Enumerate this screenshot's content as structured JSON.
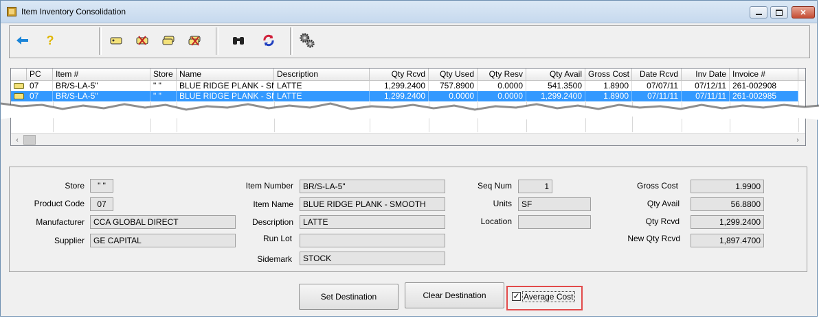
{
  "window": {
    "title": "Item Inventory Consolidation"
  },
  "toolbar": {
    "buttons": [
      {
        "name": "back-arrow-icon",
        "glyph": "🡄"
      },
      {
        "name": "help-icon",
        "glyph": "?"
      },
      {
        "name": "tag-icon",
        "glyph": "🏷"
      },
      {
        "name": "tag-delete-icon",
        "glyph": "🏷"
      },
      {
        "name": "tag-stack-icon",
        "glyph": "🏷"
      },
      {
        "name": "tag-remove-icon",
        "glyph": "🏷"
      },
      {
        "name": "binoculars-icon",
        "glyph": "👓"
      },
      {
        "name": "refresh-icon",
        "glyph": "⟳"
      },
      {
        "name": "settings-gears-icon",
        "glyph": "⚙"
      }
    ]
  },
  "grid": {
    "columns": [
      "PC",
      "Item #",
      "Store",
      "Name",
      "Description",
      "Qty Rcvd",
      "Qty Used",
      "Qty Resv",
      "Qty Avail",
      "Gross Cost",
      "Date Rcvd",
      "Inv Date",
      "Invoice #"
    ],
    "rows": [
      [
        "07",
        "BR/S-LA-5\"",
        "\" \"",
        "BLUE RIDGE PLANK - SMOOTH",
        "LATTE",
        "1,299.2400",
        "757.8900",
        "0.0000",
        "541.3500",
        "1.8900",
        "07/07/11",
        "07/12/11",
        "261-002908"
      ],
      [
        "07",
        "BR/S-LA-5\"",
        "\" \"",
        "BLUE RIDGE PLANK - SMOOTH",
        "LATTE",
        "1,299.2400",
        "0.0000",
        "0.0000",
        "1,299.2400",
        "1.8900",
        "07/11/11",
        "07/11/11",
        "261-002985"
      ]
    ],
    "selected_row": 1
  },
  "details": {
    "store": {
      "label": "Store",
      "value": "\" \""
    },
    "product_code": {
      "label": "Product Code",
      "value": "07"
    },
    "manufacturer": {
      "label": "Manufacturer",
      "value": "CCA GLOBAL DIRECT"
    },
    "supplier": {
      "label": "Supplier",
      "value": "GE CAPITAL"
    },
    "item_number": {
      "label": "Item Number",
      "value": "BR/S-LA-5\""
    },
    "item_name": {
      "label": "Item Name",
      "value": "BLUE RIDGE PLANK - SMOOTH"
    },
    "description": {
      "label": "Description",
      "value": "LATTE"
    },
    "run_lot": {
      "label": "Run Lot",
      "value": ""
    },
    "sidemark": {
      "label": "Sidemark",
      "value": "STOCK"
    },
    "seq_num": {
      "label": "Seq Num",
      "value": "1"
    },
    "units": {
      "label": "Units",
      "value": "SF"
    },
    "location": {
      "label": "Location",
      "value": ""
    },
    "gross_cost": {
      "label": "Gross Cost",
      "value": "1.9900"
    },
    "qty_avail": {
      "label": "Qty Avail",
      "value": "56.8800"
    },
    "qty_rcvd": {
      "label": "Qty Rcvd",
      "value": "1,299.2400"
    },
    "new_qty_rcvd": {
      "label": "New Qty Rcvd",
      "value": "1,897.4700"
    }
  },
  "actions": {
    "set_destination": "Set Destination",
    "clear_destination": "Clear Destination",
    "average_cost_label": "Average Cost",
    "average_cost_checked": true
  },
  "colors": {
    "selection": "#3399ff",
    "highlight_box": "#e24a4a"
  }
}
